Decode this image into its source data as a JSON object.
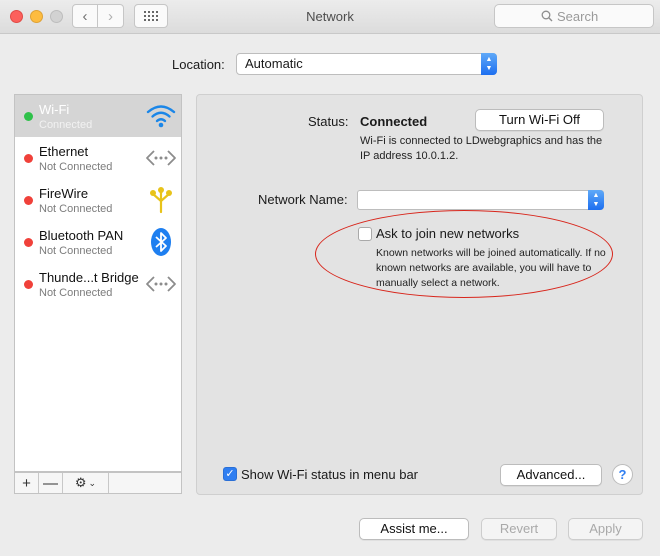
{
  "window": {
    "title": "Network",
    "search_placeholder": "Search"
  },
  "location": {
    "label": "Location:",
    "value": "Automatic"
  },
  "services": [
    {
      "name": "Wi-Fi",
      "status": "Connected",
      "status_color": "#2fc14a",
      "icon": "wifi-icon",
      "selected": true
    },
    {
      "name": "Ethernet",
      "status": "Not Connected",
      "status_color": "#f0413a",
      "icon": "ethernet-icon",
      "selected": false
    },
    {
      "name": "FireWire",
      "status": "Not Connected",
      "status_color": "#f0413a",
      "icon": "firewire-icon",
      "selected": false
    },
    {
      "name": "Bluetooth PAN",
      "status": "Not Connected",
      "status_color": "#f0413a",
      "icon": "bluetooth-icon",
      "selected": false
    },
    {
      "name": "Thunde...t Bridge",
      "status": "Not Connected",
      "status_color": "#f0413a",
      "icon": "thunderbolt-bridge-icon",
      "selected": false
    }
  ],
  "sidebar_tools": {
    "add": "+",
    "remove": "—",
    "gear": "⚙"
  },
  "detail": {
    "status_label": "Status:",
    "status_value": "Connected",
    "status_desc": "Wi-Fi is connected to LDwebgraphics and has the IP address 10.0.1.2.",
    "turn_off_label": "Turn Wi-Fi Off",
    "network_name_label": "Network Name:",
    "network_name_value": "",
    "ask_label": "Ask to join new networks",
    "ask_checked": false,
    "ask_desc": "Known networks will be joined automatically. If no known networks are available, you will have to manually select a network.",
    "show_status_label": "Show Wi-Fi status in menu bar",
    "show_status_checked": true,
    "advanced_label": "Advanced...",
    "help_label": "?"
  },
  "footer": {
    "assist_label": "Assist me...",
    "revert_label": "Revert",
    "apply_label": "Apply"
  },
  "colors": {
    "accent": "#2f7ef1",
    "annotation": "#d8261c"
  }
}
